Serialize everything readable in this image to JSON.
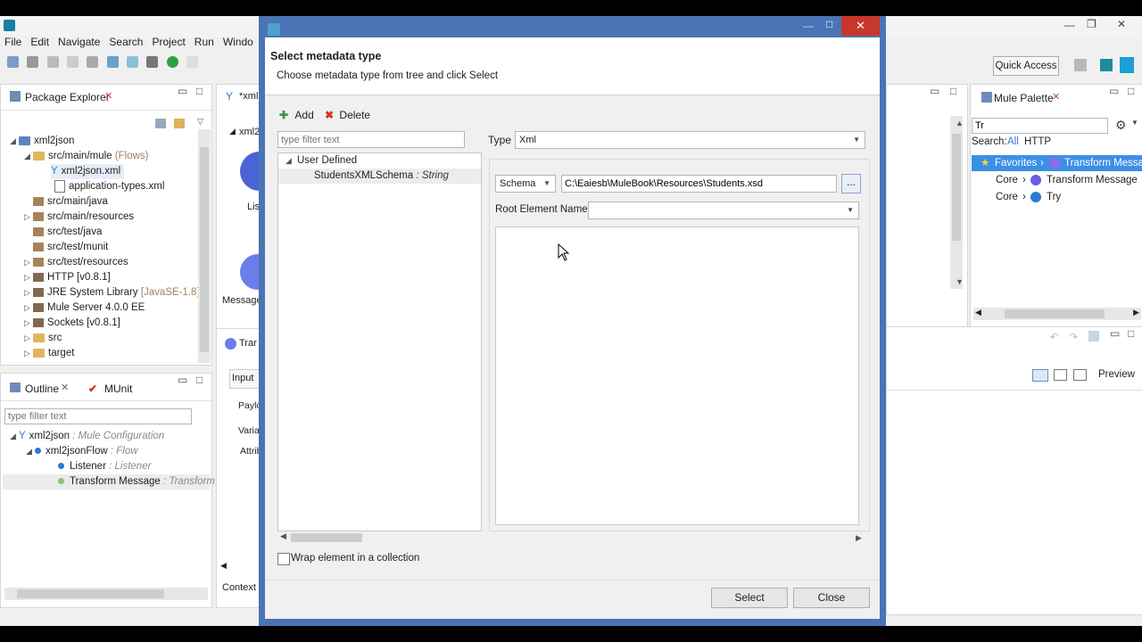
{
  "ide": {
    "menu": [
      "File",
      "Edit",
      "Navigate",
      "Search",
      "Project",
      "Run",
      "Windo"
    ],
    "quick_access": "Quick Access",
    "package_explorer": {
      "tab_label": "Package Explorer",
      "items": [
        {
          "label": "xml2json",
          "suffix": ""
        },
        {
          "label": "src/main/mule",
          "suffix": "(Flows)"
        },
        {
          "label": "xml2json.xml",
          "suffix": ""
        },
        {
          "label": "application-types.xml",
          "suffix": ""
        },
        {
          "label": "src/main/java",
          "suffix": ""
        },
        {
          "label": "src/main/resources",
          "suffix": ""
        },
        {
          "label": "src/test/java",
          "suffix": ""
        },
        {
          "label": "src/test/munit",
          "suffix": ""
        },
        {
          "label": "src/test/resources",
          "suffix": ""
        },
        {
          "label": "HTTP [v0.8.1]",
          "suffix": ""
        },
        {
          "label": "JRE System Library",
          "suffix": "[JavaSE-1.8]"
        },
        {
          "label": "Mule Server 4.0.0 EE",
          "suffix": ""
        },
        {
          "label": "Sockets [v0.8.1]",
          "suffix": ""
        },
        {
          "label": "src",
          "suffix": ""
        },
        {
          "label": "target",
          "suffix": ""
        }
      ]
    },
    "outline": {
      "tab_outline": "Outline",
      "tab_munit": "MUnit",
      "filter_placeholder": "type filter text",
      "items": [
        {
          "label": "xml2json",
          "suffix": ": Mule Configuration"
        },
        {
          "label": "xml2jsonFlow",
          "suffix": ": Flow"
        },
        {
          "label": "Listener",
          "suffix": ": Listener"
        },
        {
          "label": "Transform Message",
          "suffix": ": Transform"
        }
      ]
    },
    "editor": {
      "tab": "*xml",
      "inner_tab": "xml2",
      "listener_fragment": "Lis",
      "message_fragment": "Message",
      "transform_tab": "Trar",
      "input_tab": "Input",
      "payload": "Paylo",
      "variables": "Varia",
      "attributes": "Attrib",
      "context": "Context"
    },
    "mule_palette": {
      "tab_label": "Mule Palette",
      "search_value": "Tr",
      "search_label": "Search:",
      "filters": [
        "All",
        "HTTP"
      ],
      "results": [
        {
          "category": "Favorites",
          "label": "Transform Message"
        },
        {
          "category": "Core",
          "label": "Transform Message"
        },
        {
          "category": "Core",
          "label": "Try"
        }
      ]
    },
    "preview_label": "Preview"
  },
  "dialog": {
    "title": "Select metadata type",
    "subtitle": "Choose metadata type from tree and click Select",
    "add_label": "Add",
    "delete_label": "Delete",
    "filter_placeholder": "type filter text",
    "tree": {
      "group": "User Defined",
      "item_name": "StudentsXMLSchema",
      "item_type": ": String"
    },
    "type_label": "Type",
    "type_value": "Xml",
    "schema_select": "Schema",
    "schema_path": "C:\\Eaiesb\\MuleBook\\Resources\\Students.xsd",
    "browse_label": "...",
    "root_label": "Root Element Name",
    "root_value": "",
    "wrap_label": "Wrap element in a collection",
    "wrap_checked": false,
    "select_label": "Select",
    "close_label": "Close"
  }
}
